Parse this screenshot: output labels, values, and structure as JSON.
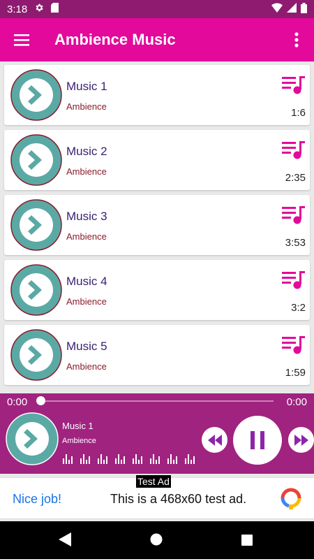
{
  "status_bar": {
    "time": "3:18",
    "icons": [
      "gear-icon",
      "sd-card-icon",
      "wifi-icon",
      "signal-icon",
      "battery-icon"
    ]
  },
  "app_bar": {
    "title": "Ambience Music",
    "icons": [
      "hamburger-menu-icon",
      "more-vert-icon"
    ]
  },
  "colors": {
    "app_bar": "#e3099a",
    "status_bar": "#8e1b6f",
    "player": "#a02380",
    "accent": "#e3099a",
    "thumb_teal": "#5ba9a4",
    "thumb_border": "#8a1c2b"
  },
  "tracks": [
    {
      "name": "Music 1",
      "artist": "Ambience",
      "duration": "1:6"
    },
    {
      "name": "Music 2",
      "artist": "Ambience",
      "duration": "2:35"
    },
    {
      "name": "Music 3",
      "artist": "Ambience",
      "duration": "3:53"
    },
    {
      "name": "Music 4",
      "artist": "Ambience",
      "duration": "3:2"
    },
    {
      "name": "Music 5",
      "artist": "Ambience",
      "duration": "1:59"
    }
  ],
  "player": {
    "current_time": "0:00",
    "total_time": "0:00",
    "progress": 0,
    "track_name": "Music 1",
    "artist": "Ambience",
    "controls": [
      "rewind-icon",
      "pause-icon",
      "fast-forward-icon"
    ]
  },
  "ad": {
    "label": "Test Ad",
    "cta": "Nice job!",
    "text": "This is a 468x60 test ad."
  },
  "nav_bar": {
    "icons": [
      "back-icon",
      "home-icon",
      "recents-icon"
    ]
  }
}
